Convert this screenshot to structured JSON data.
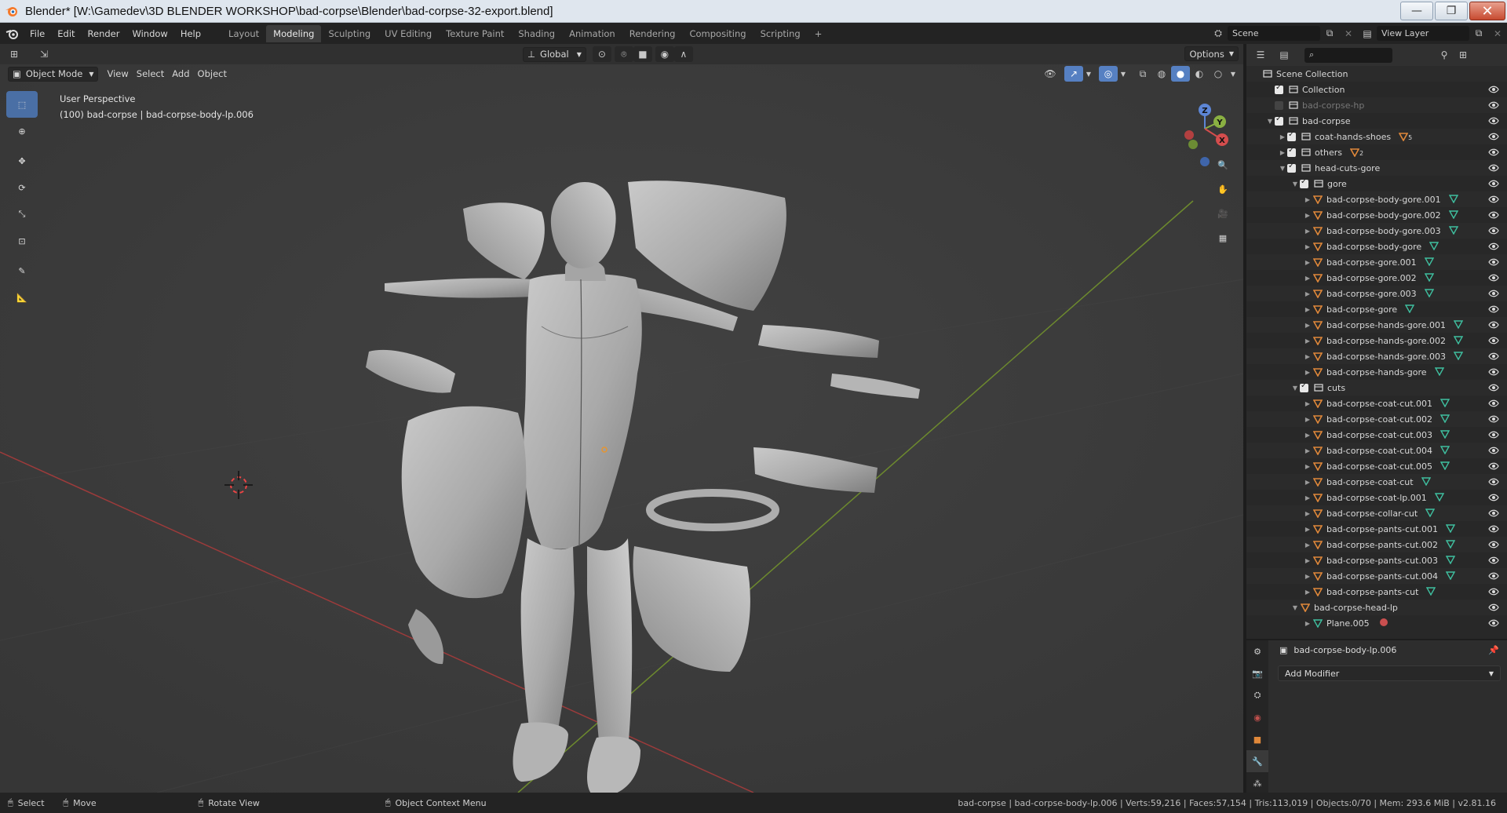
{
  "window": {
    "title": "Blender* [W:\\Gamedev\\3D BLENDER WORKSHOP\\bad-corpse\\Blender\\bad-corpse-32-export.blend]",
    "minimize": "—",
    "restore": "❐",
    "close": "✕"
  },
  "menu": [
    "File",
    "Edit",
    "Render",
    "Window",
    "Help"
  ],
  "workspaces": {
    "tabs": [
      "Layout",
      "Modeling",
      "Sculpting",
      "UV Editing",
      "Texture Paint",
      "Shading",
      "Animation",
      "Rendering",
      "Compositing",
      "Scripting"
    ],
    "active": "Modeling",
    "add": "+"
  },
  "scene": {
    "scene_name": "Scene",
    "view_layer": "View Layer"
  },
  "viewport": {
    "mode": "Object Mode",
    "menus": [
      "View",
      "Select",
      "Add",
      "Object"
    ],
    "transform_orientation": "Global",
    "options": "Options",
    "info_line1": "User Perspective",
    "info_line2": "(100) bad-corpse | bad-corpse-body-lp.006",
    "gizmo": {
      "z": "Z",
      "y": "Y",
      "x": "X"
    }
  },
  "outliner": {
    "search_placeholder": "",
    "rows": [
      {
        "label": "Scene Collection",
        "type": "scene",
        "indent": 0
      },
      {
        "label": "Collection",
        "type": "collection",
        "indent": 1,
        "checked": true
      },
      {
        "label": "bad-corpse-hp",
        "type": "collection",
        "indent": 1,
        "checked": false,
        "dim": true
      },
      {
        "label": "bad-corpse",
        "type": "collection",
        "indent": 1,
        "checked": true,
        "expanded": true
      },
      {
        "label": "coat-hands-shoes",
        "type": "collection",
        "indent": 2,
        "checked": true,
        "badge": "5",
        "collapsed": true
      },
      {
        "label": "others",
        "type": "collection",
        "indent": 2,
        "checked": true,
        "badge": "2",
        "collapsed": true
      },
      {
        "label": "head-cuts-gore",
        "type": "collection",
        "indent": 2,
        "checked": true,
        "expanded": true
      },
      {
        "label": "gore",
        "type": "collection",
        "indent": 3,
        "checked": true,
        "expanded": true
      },
      {
        "label": "bad-corpse-body-gore.001",
        "type": "object",
        "indent": 4
      },
      {
        "label": "bad-corpse-body-gore.002",
        "type": "object",
        "indent": 4
      },
      {
        "label": "bad-corpse-body-gore.003",
        "type": "object",
        "indent": 4
      },
      {
        "label": "bad-corpse-body-gore",
        "type": "object",
        "indent": 4
      },
      {
        "label": "bad-corpse-gore.001",
        "type": "object",
        "indent": 4
      },
      {
        "label": "bad-corpse-gore.002",
        "type": "object",
        "indent": 4
      },
      {
        "label": "bad-corpse-gore.003",
        "type": "object",
        "indent": 4
      },
      {
        "label": "bad-corpse-gore",
        "type": "object",
        "indent": 4
      },
      {
        "label": "bad-corpse-hands-gore.001",
        "type": "object",
        "indent": 4
      },
      {
        "label": "bad-corpse-hands-gore.002",
        "type": "object",
        "indent": 4
      },
      {
        "label": "bad-corpse-hands-gore.003",
        "type": "object",
        "indent": 4
      },
      {
        "label": "bad-corpse-hands-gore",
        "type": "object",
        "indent": 4
      },
      {
        "label": "cuts",
        "type": "collection",
        "indent": 3,
        "checked": true,
        "expanded": true
      },
      {
        "label": "bad-corpse-coat-cut.001",
        "type": "object",
        "indent": 4
      },
      {
        "label": "bad-corpse-coat-cut.002",
        "type": "object",
        "indent": 4
      },
      {
        "label": "bad-corpse-coat-cut.003",
        "type": "object",
        "indent": 4
      },
      {
        "label": "bad-corpse-coat-cut.004",
        "type": "object",
        "indent": 4
      },
      {
        "label": "bad-corpse-coat-cut.005",
        "type": "object",
        "indent": 4
      },
      {
        "label": "bad-corpse-coat-cut",
        "type": "object",
        "indent": 4
      },
      {
        "label": "bad-corpse-coat-lp.001",
        "type": "object",
        "indent": 4
      },
      {
        "label": "bad-corpse-collar-cut",
        "type": "object",
        "indent": 4
      },
      {
        "label": "bad-corpse-pants-cut.001",
        "type": "object",
        "indent": 4
      },
      {
        "label": "bad-corpse-pants-cut.002",
        "type": "object",
        "indent": 4
      },
      {
        "label": "bad-corpse-pants-cut.003",
        "type": "object",
        "indent": 4
      },
      {
        "label": "bad-corpse-pants-cut.004",
        "type": "object",
        "indent": 4
      },
      {
        "label": "bad-corpse-pants-cut",
        "type": "object",
        "indent": 4
      },
      {
        "label": "bad-corpse-head-lp",
        "type": "object",
        "indent": 3,
        "expanded": true
      },
      {
        "label": "Plane.005",
        "type": "mesh",
        "indent": 4,
        "material": true
      }
    ]
  },
  "properties": {
    "object_name": "bad-corpse-body-lp.006",
    "add_modifier": "Add Modifier"
  },
  "statusbar": {
    "select": "Select",
    "move": "Move",
    "rotate": "Rotate View",
    "context_menu": "Object Context Menu",
    "stats": "bad-corpse | bad-corpse-body-lp.006 | Verts:59,216 | Faces:57,154 | Tris:113,019 | Objects:0/70 | Mem: 293.6 MiB | v2.81.16"
  },
  "colors": {
    "accent": "#5680c2",
    "object_orange": "#e0883a",
    "modifier_green": "#3fc0a0"
  }
}
